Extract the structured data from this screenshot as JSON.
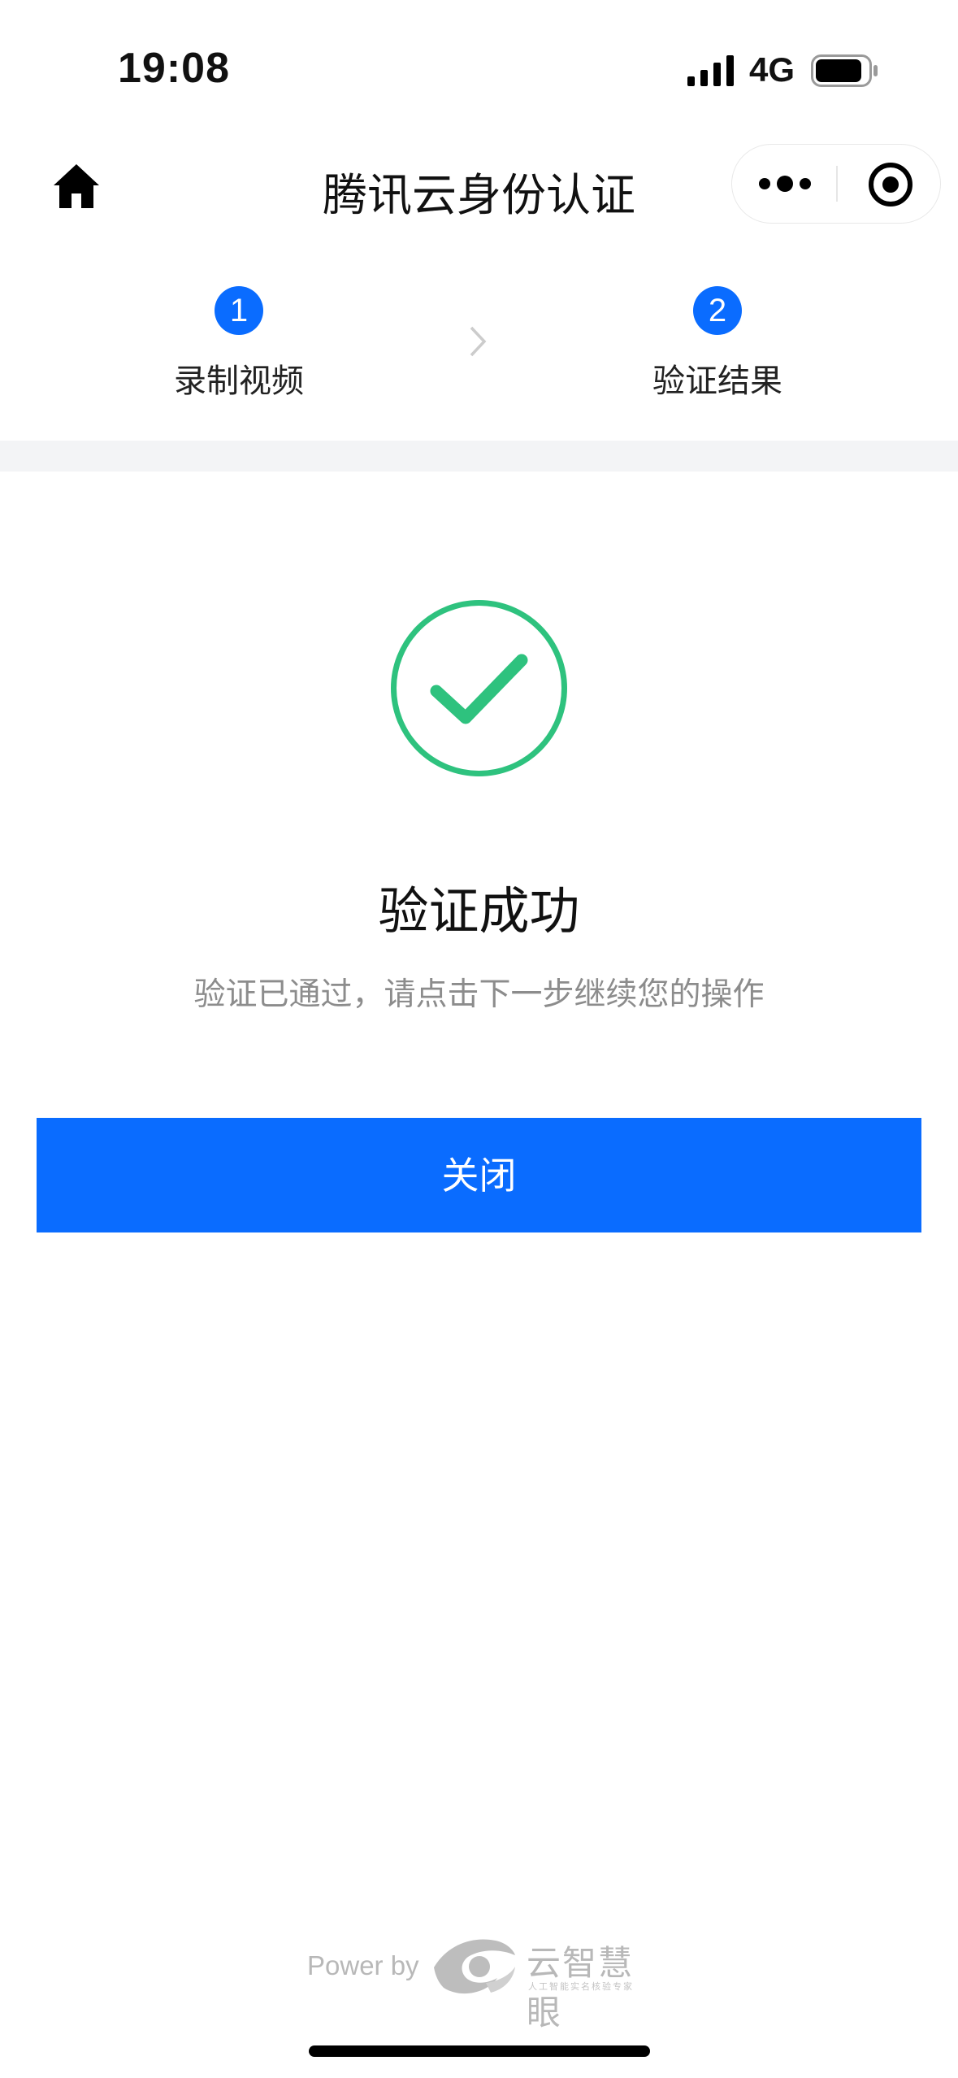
{
  "status_bar": {
    "time": "19:08",
    "network": "4G"
  },
  "nav": {
    "title": "腾讯云身份认证"
  },
  "steps": [
    {
      "number": "1",
      "label": "录制视频"
    },
    {
      "number": "2",
      "label": "验证结果"
    }
  ],
  "result": {
    "title": "验证成功",
    "description": "验证已通过，请点击下一步继续您的操作"
  },
  "actions": {
    "close_label": "关闭"
  },
  "footer": {
    "power_by": "Power by",
    "brand": "云智慧眼",
    "slogan": "人工智能实名核验专家"
  },
  "colors": {
    "primary": "#0a6cff",
    "success": "#2ec27e",
    "muted_text": "#8c8c8c"
  }
}
